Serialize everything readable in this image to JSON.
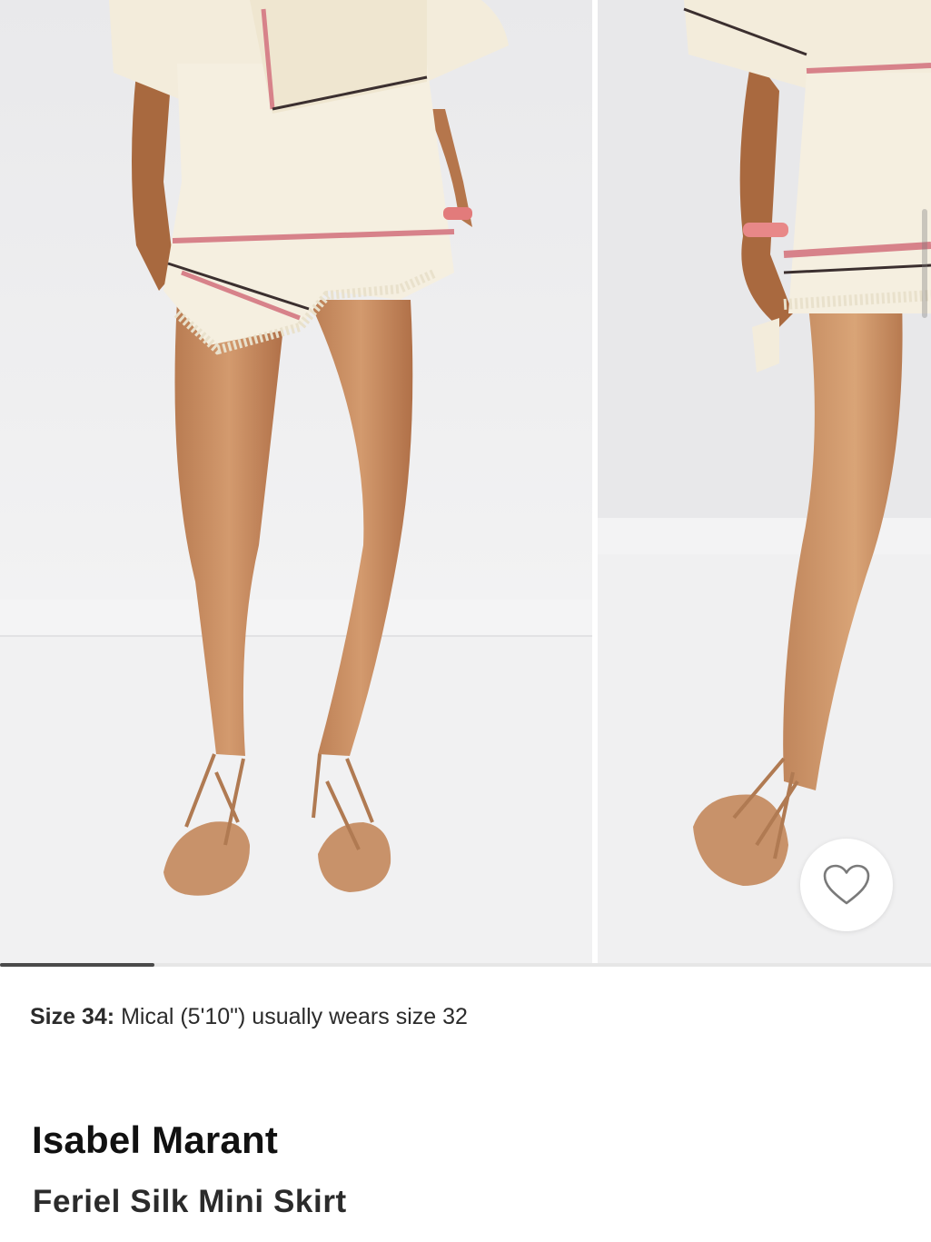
{
  "gallery": {
    "images": [
      {
        "icon": "product-photo-front-view"
      },
      {
        "icon": "product-photo-side-view"
      }
    ],
    "progress_fraction": 0.166,
    "wishlist_icon": "heart-outline-icon"
  },
  "fit": {
    "size_label": "Size 34:",
    "model_note": "Mical (5'10\") usually wears size 32"
  },
  "product": {
    "brand": "Isabel Marant",
    "name": "Feriel Silk Mini Skirt"
  },
  "colors": {
    "accent": "#4a4a4a",
    "photo_background": "#ededed",
    "garment": "#f3ecdb"
  }
}
